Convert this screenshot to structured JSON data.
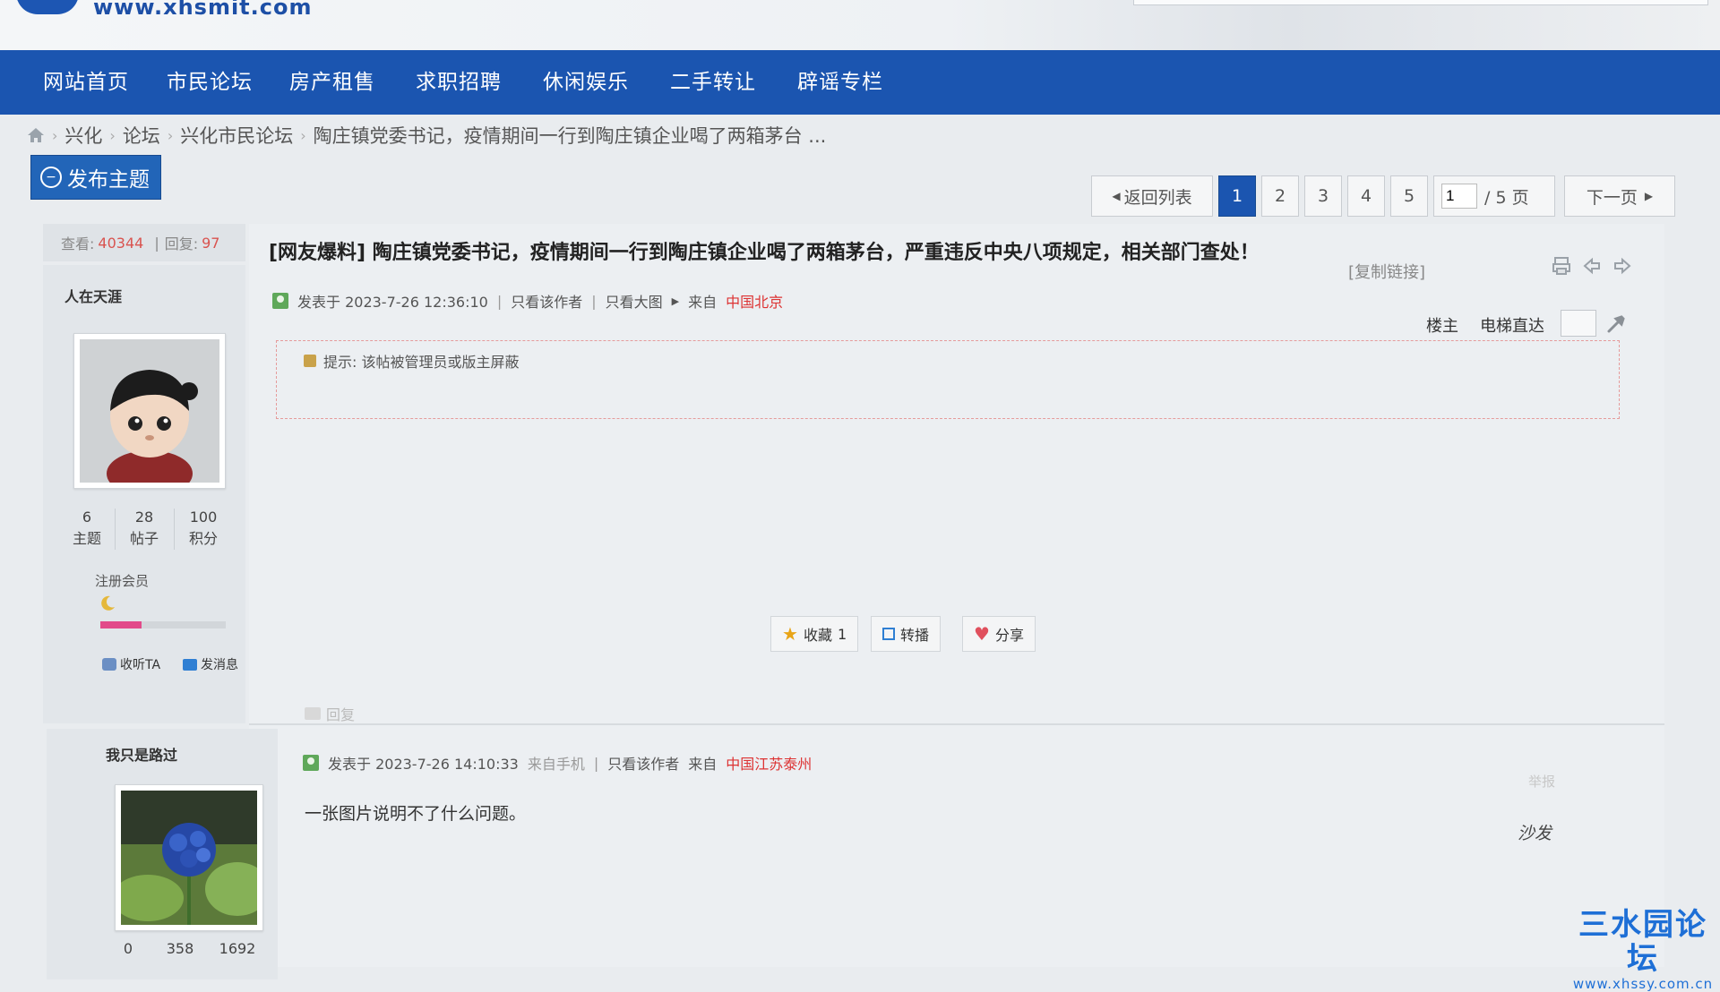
{
  "header": {
    "site_url": "www.xhsmit.com"
  },
  "nav": {
    "items": [
      "网站首页",
      "市民论坛",
      "房产租售",
      "求职招聘",
      "休闲娱乐",
      "二手转让",
      "辟谣专栏"
    ]
  },
  "breadcrumb": {
    "items": [
      "兴化",
      "论坛",
      "兴化市民论坛",
      "陶庄镇党委书记，疫情期间一行到陶庄镇企业喝了两箱茅台 ..."
    ]
  },
  "toolbar": {
    "post_new_label": "发布主题"
  },
  "pagination": {
    "back_label": "返回列表",
    "pages": [
      "1",
      "2",
      "3",
      "4",
      "5"
    ],
    "current": "1",
    "input_value": "1",
    "total_label": "/ 5 页",
    "next_label": "下一页"
  },
  "thread": {
    "views_label": "查看:",
    "views": "40344",
    "replies_label": "回复:",
    "replies": "97",
    "title": "[网友爆料] 陶庄镇党委书记，疫情期间一行到陶庄镇企业喝了两箱茅台，严重违反中央八项规定，相关部门查处！",
    "copy_link_label": "[复制链接]"
  },
  "post1": {
    "author": "人在天涯",
    "stats": [
      {
        "value": "6",
        "label": "主题"
      },
      {
        "value": "28",
        "label": "帖子"
      },
      {
        "value": "100",
        "label": "积分"
      }
    ],
    "group": "注册会员",
    "level_progress": 0.33,
    "follow_label": "收听TA",
    "message_label": "发消息",
    "posted_at": "发表于 2023-7-26 12:36:10",
    "only_author": "只看该作者",
    "only_large_image": "只看大图",
    "from_label": "来自",
    "location": "中国北京",
    "floor_label": "楼主",
    "elevator_label": "电梯直达",
    "notice": "提示: 该帖被管理员或版主屏蔽",
    "favorite_label": "收藏",
    "favorite_count": "1",
    "repost_label": "转播",
    "share_label": "分享",
    "reply_label": "回复"
  },
  "post2": {
    "author": "我只是路过",
    "stats": [
      {
        "value": "0",
        "label": ""
      },
      {
        "value": "358",
        "label": ""
      },
      {
        "value": "1692",
        "label": ""
      }
    ],
    "posted_at": "发表于 2023-7-26 14:10:33",
    "from_mobile": "来自手机",
    "only_author": "只看该作者",
    "from_label": "来自",
    "location": "中国江苏泰州",
    "body": "一张图片说明不了什么问题。",
    "report_label": "举报",
    "floor_label": "沙发"
  },
  "watermark": {
    "title": "三水园论坛",
    "url": "www.xhssy.com.cn"
  },
  "colors": {
    "nav": "#1b55b0",
    "accent_red": "#dd3333",
    "watermark": "#1e6fd6"
  }
}
